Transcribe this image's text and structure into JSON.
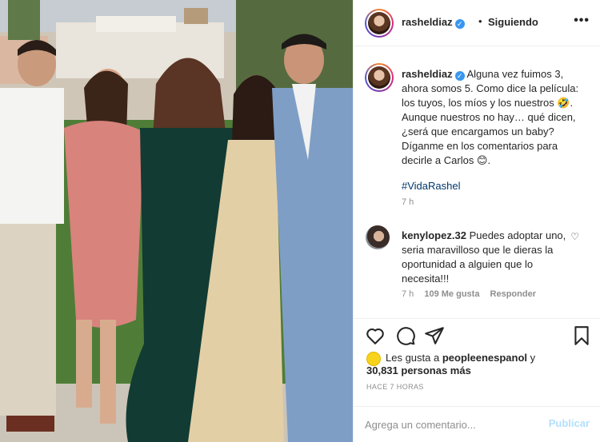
{
  "post": {
    "username": "rasheldiaz",
    "verified_mark": "✓",
    "separator": "•",
    "follow_status": "Siguiendo",
    "more_icon": "•••"
  },
  "caption": {
    "username": "rasheldiaz",
    "text": "Alguna vez fuimos 3, ahora somos 5. Como dice la película: los tuyos, los míos y los nuestros 🤣. Aunque nuestros no hay… qué dicen, ¿será que encargamos un baby? Díganme en los comentarios para decirle a Carlos 😊.",
    "hashtag": "#VidaRashel",
    "time": "7 h"
  },
  "comment": {
    "username": "kenylopez.32",
    "text": "Puedes adoptar uno, seria maravilloso que le dieras la oportunidad a alguien que lo necesita!!!",
    "time": "7 h",
    "likes": "109 Me gusta",
    "reply": "Responder",
    "heart_icon": "♡"
  },
  "likes": {
    "prefix": "Les gusta a",
    "by_user": "peopleenespanol",
    "suffix": "y",
    "count_text": "30,831 personas más"
  },
  "time_ago": "HACE 7 HORAS",
  "comment_box": {
    "placeholder": "Agrega un comentario...",
    "post_label": "Publicar"
  },
  "icons": [
    "heart-icon",
    "comment-icon",
    "share-icon",
    "bookmark-icon",
    "more-icon"
  ],
  "colors": {
    "link": "#00376b",
    "verified": "#3897f0",
    "muted": "#8e8e8e",
    "post_disabled": "#b2dffc"
  }
}
